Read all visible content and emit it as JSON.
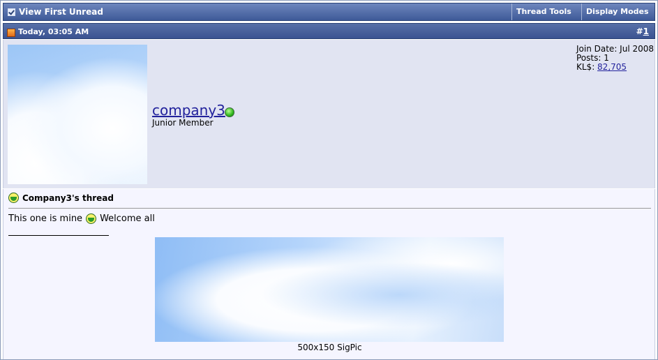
{
  "toolbar": {
    "view_first_unread": "View First Unread",
    "thread_tools": "Thread Tools",
    "display_modes": "Display Modes"
  },
  "post": {
    "date": "Today, 03:05 AM",
    "number_prefix": "#",
    "number": "1",
    "user": {
      "name": "company3",
      "title": "Junior Member",
      "online_status": "online",
      "join_date": "Join Date: Jul 2008",
      "posts": "Posts: 1",
      "kl_label": "KL$: ",
      "kl_value": "82,705"
    },
    "title": "Company3's thread",
    "message_part1": "This one is mine",
    "message_part2": "Welcome all",
    "signature_caption": "500x150 SigPic"
  },
  "colors": {
    "bar_blue": "#3e5a98",
    "panel_bg": "#e1e4f2",
    "body_bg": "#f5f5ff",
    "link": "#22229c"
  },
  "icons": [
    "checkbox-icon",
    "chevron-down-icon",
    "post-icon",
    "online-status-icon",
    "grin-smiley-icon"
  ]
}
